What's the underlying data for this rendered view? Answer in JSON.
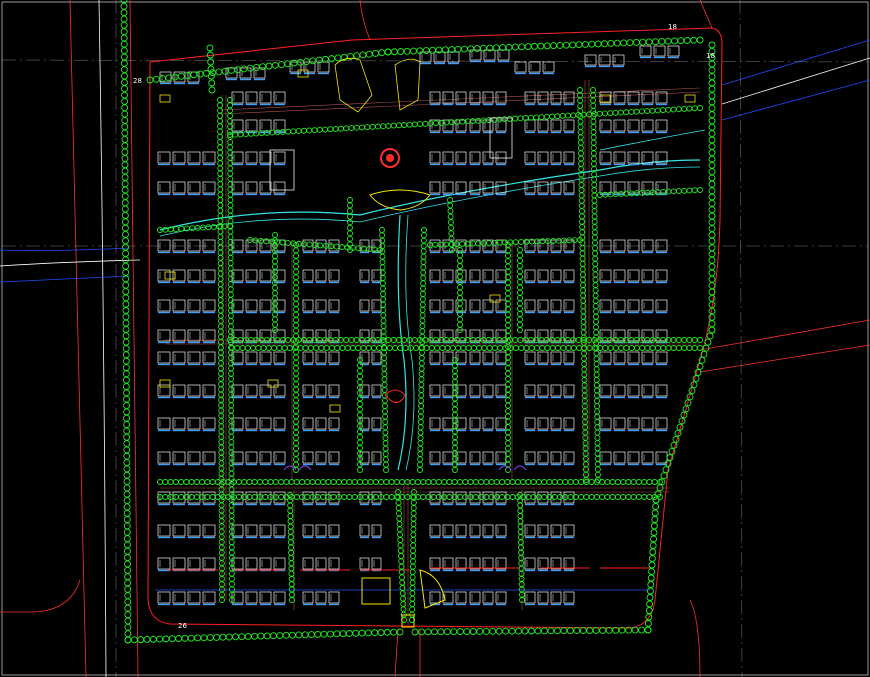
{
  "drawing": {
    "background": "#000000",
    "colors": {
      "boundary": "#ff2020",
      "trees": "#22ee22",
      "buildings": "#f2f2f2",
      "building_shadow": "#3aa0ff",
      "yellow": "#f5e600",
      "water": "#33e5e5",
      "river": "#1e4cff",
      "centerline": "#cfcfcf",
      "road_edge": "#b05050",
      "landmark": "#ff2a2a"
    }
  },
  "labels": {
    "top_right_a": "18",
    "top_right_b": "18",
    "left_top": "28",
    "bottom_left": "26",
    "west_road": "",
    "south_entry": ""
  }
}
